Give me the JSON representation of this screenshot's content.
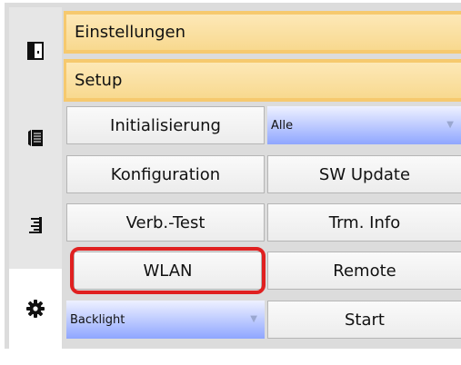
{
  "sidebar": {
    "icons": [
      "panel-icon",
      "receipt-icon",
      "list-icon",
      "gear-icon"
    ]
  },
  "header": {
    "title": "Einstellungen",
    "subtitle": "Setup"
  },
  "buttons": {
    "initialisierung": "Initialisierung",
    "konfiguration": "Konfiguration",
    "sw_update": "SW Update",
    "verb_test": "Verb.-Test",
    "trm_info": "Trm. Info",
    "wlan": "WLAN",
    "remote": "Remote",
    "start": "Start"
  },
  "selects": {
    "scope": {
      "value": "Alle"
    },
    "backlight": {
      "value": "Backlight"
    }
  },
  "colors": {
    "header_bar": "#f6c96e",
    "select_gradient": "#8fa6ff",
    "highlight": "#e02020"
  }
}
